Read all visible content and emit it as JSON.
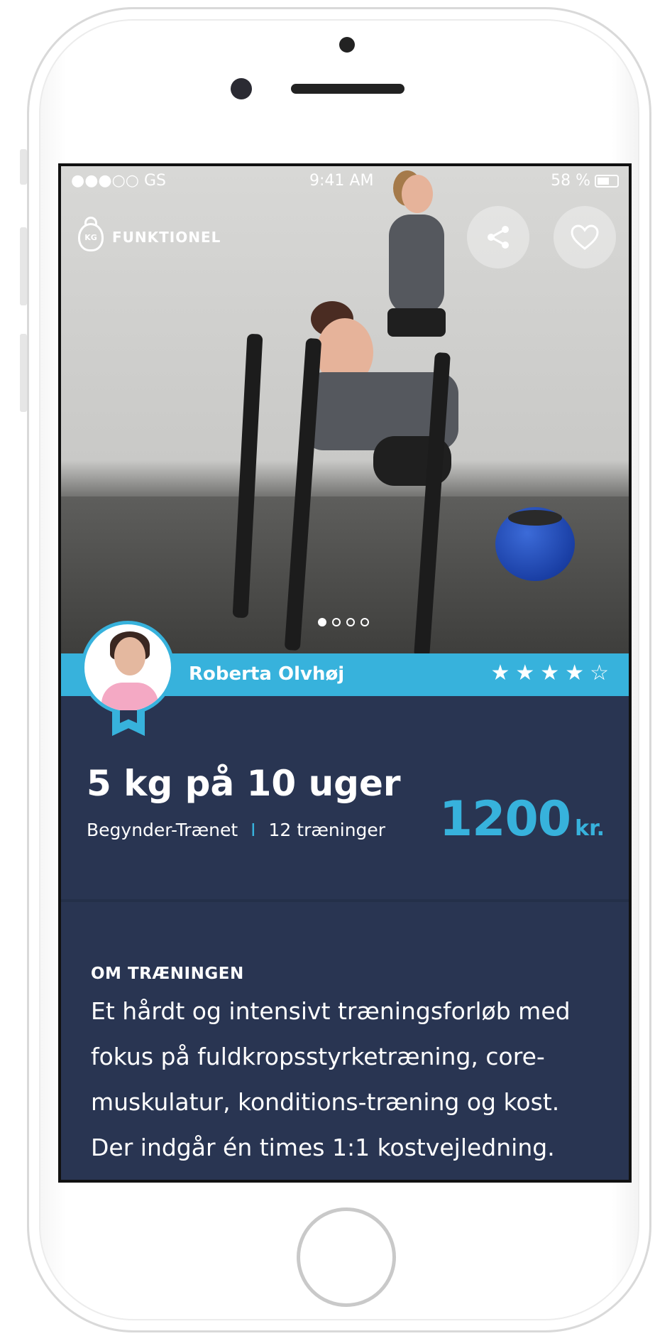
{
  "status_bar": {
    "carrier": "●●●○○ GS",
    "time": "9:41 AM",
    "battery": "58 %"
  },
  "category": {
    "icon_label": "KG",
    "label": "FUNKTIONEL"
  },
  "actions": {
    "share_icon": "share-icon",
    "favorite_icon": "heart-icon"
  },
  "carousel": {
    "count": 4,
    "active_index": 0
  },
  "coach": {
    "name": "Roberta Olvhøj",
    "rating": 4,
    "max_rating": 5
  },
  "program": {
    "title": "5 kg på 10 uger",
    "level": "Begynder-Trænet",
    "separator": "I",
    "sessions": "12 træninger",
    "price": "1200",
    "currency": "kr."
  },
  "about": {
    "heading": "OM TRÆNINGEN",
    "text": "Et hårdt og intensivt træningsforløb med fokus på fuldkropsstyrketræning, core-muskulatur, konditions-træning og kost. Der indgår én times 1:1 kostvejledning."
  },
  "colors": {
    "accent": "#37b2dc",
    "background": "#293552"
  }
}
